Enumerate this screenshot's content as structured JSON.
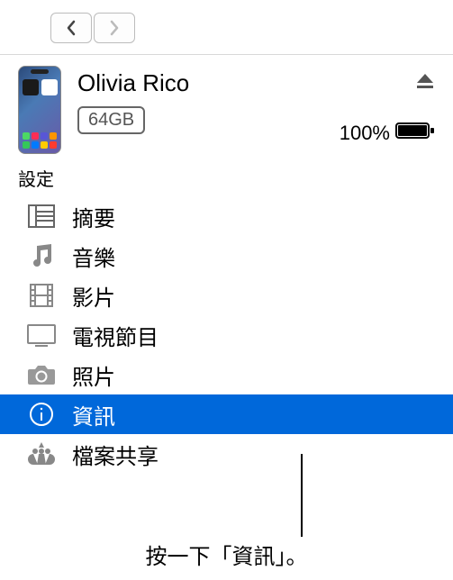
{
  "device": {
    "name": "Olivia Rico",
    "storage": "64GB",
    "battery_pct": "100%"
  },
  "section_label": "設定",
  "sidebar": {
    "items": [
      {
        "label": "摘要"
      },
      {
        "label": "音樂"
      },
      {
        "label": "影片"
      },
      {
        "label": "電視節目"
      },
      {
        "label": "照片"
      },
      {
        "label": "資訊"
      },
      {
        "label": "檔案共享"
      }
    ]
  },
  "callout": "按一下「資訊」。",
  "colors": {
    "selected_bg": "#0068da",
    "app_icons": [
      "#4cd964",
      "#ff2d55",
      "#5856d6",
      "#ff9500",
      "#34c759",
      "#007aff",
      "#ffcc00",
      "#ff3b30"
    ]
  }
}
